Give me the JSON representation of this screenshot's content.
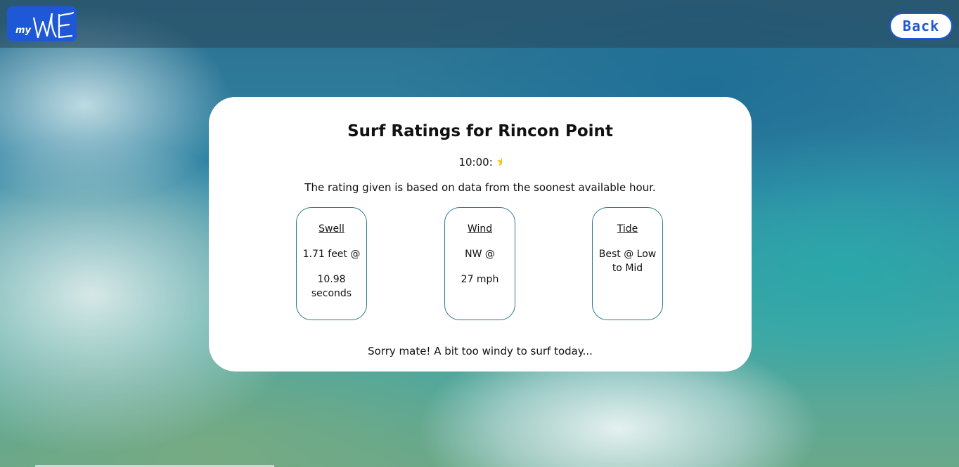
{
  "header": {
    "logo_prefix": "my",
    "logo_mark": "WAVE",
    "back_label": "Back"
  },
  "card": {
    "title": "Surf Ratings for Rincon Point",
    "time": "10:00:",
    "rating_stars": 0.5,
    "star_color": "#f5c518",
    "description": "The rating given is based on data from the soonest available hour.",
    "metrics": [
      {
        "title": "Swell",
        "line1": "1.71 feet @",
        "line2": "10.98 seconds"
      },
      {
        "title": "Wind",
        "line1": "NW @",
        "line2": "27 mph"
      },
      {
        "title": "Tide",
        "line1": "Best @ Low to Mid",
        "line2": ""
      }
    ],
    "verdict": "Sorry mate! A bit too windy to surf today..."
  },
  "colors": {
    "brand_blue": "#1f58d6",
    "card_border": "#2b7a8c"
  }
}
